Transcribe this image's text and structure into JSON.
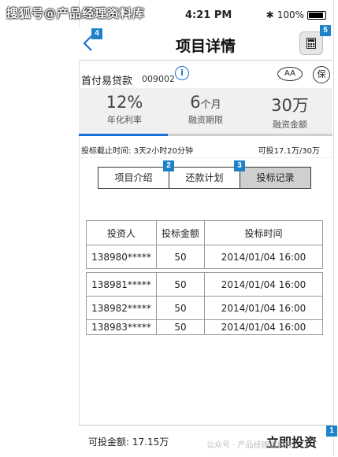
{
  "watermark_top": "搜狐号@产品经理资料库",
  "watermark_bottom": "公众号 · 产品经理资料库",
  "status": {
    "carrier": "BELL",
    "time": "4:21 PM",
    "battery": "100%"
  },
  "nav": {
    "back_icon": "chevron-left-icon",
    "title": "项目详情",
    "calc_icon": "calculator-icon"
  },
  "markers": {
    "back": "4",
    "calc": "5",
    "tab_repay": "2",
    "tab_records": "3",
    "invest": "1"
  },
  "product": {
    "name": "首付易贷款",
    "code": "009002",
    "info": "i",
    "font_toggle": "AA",
    "guarantee": "保"
  },
  "stats": [
    {
      "value": "12%",
      "unit": "",
      "label": "年化利率"
    },
    {
      "value": "6",
      "unit": "个月",
      "label": "融资期限"
    },
    {
      "value": "30万",
      "unit": "",
      "label": "融资金额"
    }
  ],
  "progress": {
    "fraction": 0.35,
    "color": "#1b6fd6"
  },
  "deadline": {
    "left": "投标截止时间: 3天2小时20分钟",
    "right": "可投17.1万/30万"
  },
  "tabs": [
    {
      "label": "项目介绍",
      "active": false
    },
    {
      "label": "还款计划",
      "active": false
    },
    {
      "label": "投标记录",
      "active": true
    }
  ],
  "table": {
    "headers": [
      "投资人",
      "投标金额",
      "投标时间"
    ],
    "rows": [
      [
        "138980*****",
        "50",
        "2014/01/04 16:00"
      ],
      [
        "138981*****",
        "50",
        "2014/01/04 16:00"
      ],
      [
        "138982*****",
        "50",
        "2014/01/04 16:00"
      ],
      [
        "138983*****",
        "50",
        "2014/01/04 16:00"
      ]
    ]
  },
  "footer": {
    "amount_label": "可投金额:",
    "amount_value": "17.15万",
    "invest_button": "立即投资"
  }
}
